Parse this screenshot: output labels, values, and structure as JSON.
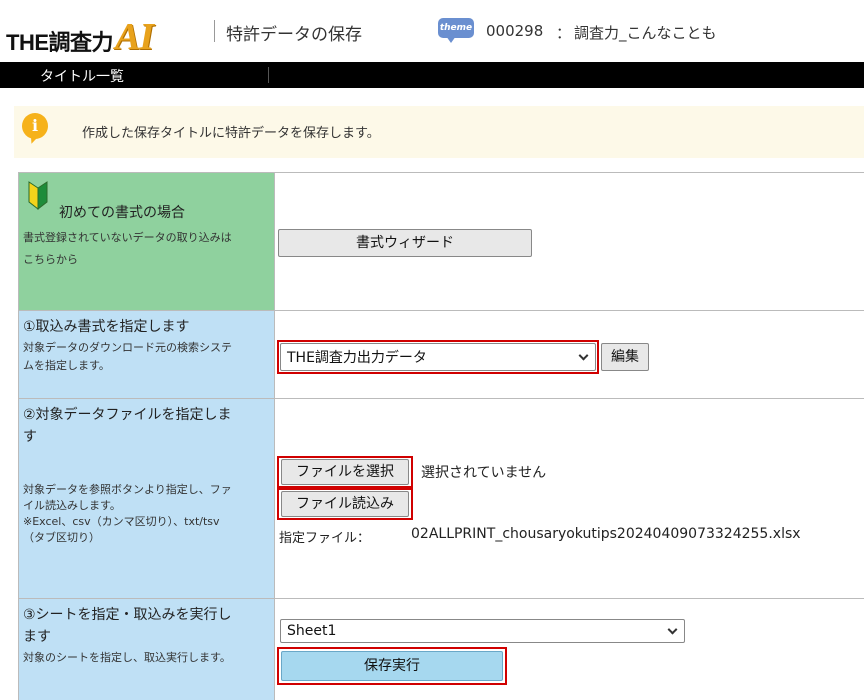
{
  "header": {
    "logo_prefix": "THE調査力",
    "logo_suffix": "AI",
    "title": "特許データの保存",
    "theme_icon_label": "theme",
    "theme_id": "000298",
    "theme_separator": "：",
    "theme_name": "調査力_こんなことも"
  },
  "nav": {
    "items": [
      {
        "label": "タイトル一覧"
      }
    ]
  },
  "banner": {
    "icon_label": "i",
    "text": "作成した保存タイトルに特許データを保存します。"
  },
  "sections": {
    "wizard": {
      "heading": "初めての書式の場合",
      "desc_line1": "書式登録されていないデータの取り込みは",
      "desc_line2": "こちらから",
      "button_label": "書式ウィザード"
    },
    "format": {
      "heading": "①取込み書式を指定します",
      "desc_line1": "対象データのダウンロード元の検索システ",
      "desc_line2": "ムを指定します。",
      "selected_value": "THE調査力出力データ",
      "edit_label": "編集"
    },
    "file": {
      "heading_line1": "②対象データファイルを指定しま",
      "heading_line2": "す",
      "desc_line1": "対象データを参照ボタンより指定し、ファ",
      "desc_line2": "イル読込みします。",
      "desc_line3": "※Excel、csv（カンマ区切り）、txt/tsv",
      "desc_line4": "（タブ区切り）",
      "choose_label": "ファイルを選択",
      "no_file_text": "選択されていません",
      "load_label": "ファイル読込み",
      "specified_label": "指定ファイル：",
      "specified_value": "02ALLPRINT_chousaryokutips20240409073324255.xlsx"
    },
    "sheet": {
      "heading_line1": "③シートを指定・取込みを実行し",
      "heading_line2": "ます",
      "desc": "対象のシートを指定し、取込実行します。",
      "selected_value": "Sheet1",
      "execute_label": "保存実行"
    }
  },
  "colors": {
    "highlight": "#d00000",
    "green_cell": "#8fd19e",
    "blue_cell": "#bfe0f5",
    "primary_button": "#a6d8ef",
    "logo_accent": "#e8a21c"
  }
}
